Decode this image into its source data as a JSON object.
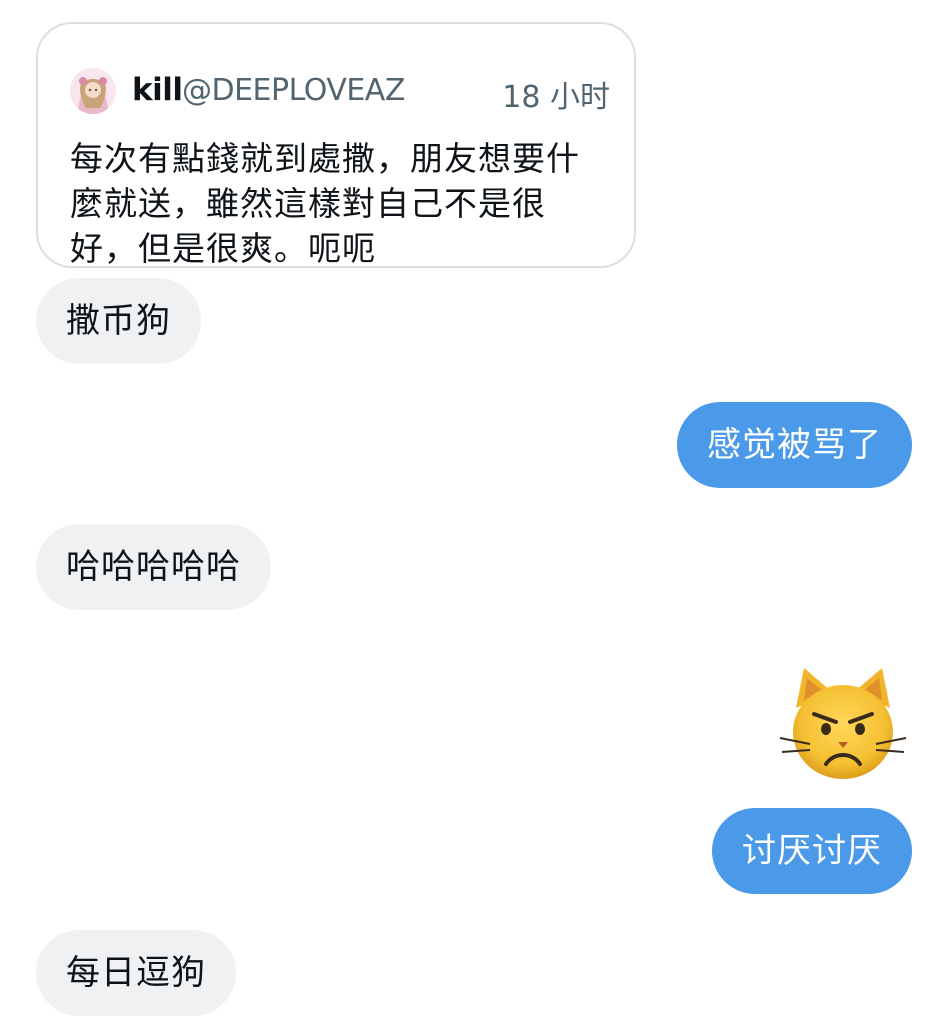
{
  "quoted_post": {
    "author_name": "kill",
    "author_handle": "@DEEPLOVEAZ",
    "time": "18 小时",
    "text": "每次有點錢就到處撒，朋友想要什麼就送，雖然這樣對自己不是很好，但是很爽。呃呃"
  },
  "messages": [
    {
      "direction": "incoming",
      "text": "撒币狗"
    },
    {
      "direction": "outgoing",
      "text": "感觉被骂了"
    },
    {
      "direction": "incoming",
      "text": "哈哈哈哈哈"
    },
    {
      "direction": "outgoing",
      "emoji": "pouting-cat-face-icon"
    },
    {
      "direction": "outgoing",
      "text": "讨厌讨厌"
    },
    {
      "direction": "incoming",
      "text": "每日逗狗"
    }
  ],
  "colors": {
    "outgoing_bubble": "#4a9ae9",
    "incoming_bubble": "#eff1f3",
    "border": "#dcdfe2",
    "secondary_text": "#536471"
  }
}
